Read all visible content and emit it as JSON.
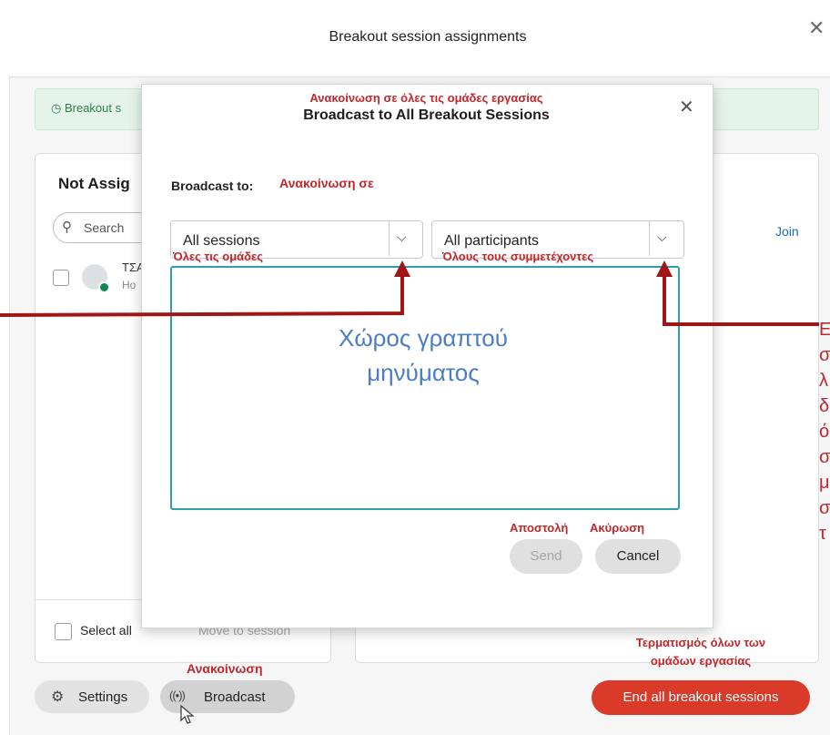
{
  "window": {
    "title": "Breakout session assignments",
    "close_icon": "close-icon"
  },
  "banner": {
    "text": "Breakout s",
    "icon": "clock-icon"
  },
  "left_panel": {
    "heading": "Not Assig",
    "search_placeholder": "Search",
    "participant": {
      "name": "ΤΣΑ",
      "role": "Ho"
    },
    "select_all": "Select all",
    "move_to_session": "Move to session"
  },
  "right_panel": {
    "join": "Join"
  },
  "bottom_bar": {
    "settings": "Settings",
    "broadcast": "Broadcast",
    "end_all": "End all breakout sessions"
  },
  "modal": {
    "title": "Broadcast to All Breakout Sessions",
    "broadcast_to_label": "Broadcast to:",
    "sessions_select": "All sessions",
    "participants_select": "All participants",
    "message_value": "",
    "send": "Send",
    "cancel": "Cancel"
  },
  "annotations": {
    "title_gr": "Ανακοίνωση σε όλες τις ομάδες εργασίας",
    "broadcast_to_gr": "Ανακοίνωση σε",
    "all_sessions_gr": "Όλες τις ομάδες",
    "all_participants_gr": "Όλους τους συμμετέχοντες",
    "message_area_line1": "Χώρος γραπτού",
    "message_area_line2": "μηνύματος",
    "send_gr": "Αποστολή",
    "cancel_gr": "Ακύρωση",
    "broadcast_gr": "Ανακοίνωση",
    "end_all_line1": "Τερματισμός όλων των",
    "end_all_line2": "ομάδων εργασίας",
    "side_note_letters": [
      "Ε",
      "σ",
      "λ",
      "δ",
      "ό",
      "σ",
      "μ",
      "σ",
      "τ"
    ]
  },
  "colors": {
    "accent_red": "#d93a2a",
    "annotation_red": "#c3262a",
    "arrow_red": "#a01515",
    "textarea_border": "#2f9fae",
    "placeholder_blue": "#4a7ec4",
    "banner_green": "#2f7d45"
  }
}
